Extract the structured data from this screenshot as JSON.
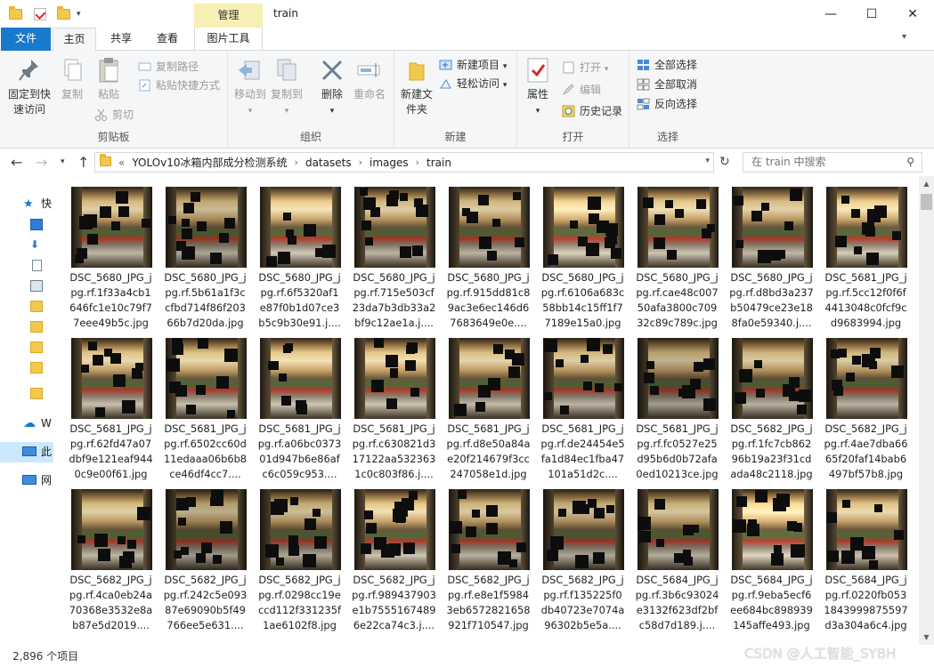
{
  "window": {
    "title": "train",
    "manage_tab": "管理",
    "minimize": "—",
    "maximize": "☐",
    "close": "✕"
  },
  "tabs": {
    "file": "文件",
    "home": "主页",
    "share": "共享",
    "view": "查看",
    "picture_tools": "图片工具"
  },
  "ribbon": {
    "clipboard": {
      "label": "剪贴板",
      "pin": "固定到快速访问",
      "copy": "复制",
      "paste": "粘贴",
      "copy_path": "复制路径",
      "paste_shortcut": "粘贴快捷方式",
      "cut": "剪切"
    },
    "organize": {
      "label": "组织",
      "move_to": "移动到",
      "copy_to": "复制到",
      "delete": "删除",
      "rename": "重命名"
    },
    "new": {
      "label": "新建",
      "new_folder": "新建文件夹",
      "new_item": "新建项目",
      "easy_access": "轻松访问"
    },
    "open": {
      "label": "打开",
      "properties": "属性",
      "open": "打开",
      "edit": "编辑",
      "history": "历史记录"
    },
    "select": {
      "label": "选择",
      "select_all": "全部选择",
      "select_none": "全部取消",
      "invert": "反向选择"
    }
  },
  "address": {
    "overflow": "«",
    "crumbs": [
      "YOLOv10冰箱内部成分检测系统",
      "datasets",
      "images",
      "train"
    ],
    "search_placeholder": "在 train 中搜索"
  },
  "navpane": {
    "quick": "快",
    "onedrive": "W",
    "thispc": "此",
    "network": "网"
  },
  "files": [
    "DSC_5680_JPG_jpg.rf.1f33a4cb1646fc1e10c79f77eee49b5c.jpg",
    "DSC_5680_JPG_jpg.rf.5b61a1f3ccfbd714f86f20366b7d20da.jpg",
    "DSC_5680_JPG_jpg.rf.6f5320af1e87f0b1d07ce3b5c9b30e91.j....",
    "DSC_5680_JPG_jpg.rf.715e503cf23da7b3db33a2bf9c12ae1a.j....",
    "DSC_5680_JPG_jpg.rf.915dd81c89ac3e6ec146d67683649e0e....",
    "DSC_5680_JPG_jpg.rf.6106a683c58bb14c15ff1f77189e15a0.jpg",
    "DSC_5680_JPG_jpg.rf.cae48c00750afa3800c70932c89c789c.jpg",
    "DSC_5680_JPG_jpg.rf.d8bd3a237b50479ce23e188fa0e59340.j....",
    "DSC_5681_JPG_jpg.rf.5cc12f0f6f4413048c0fcf9cd9683994.jpg",
    "DSC_5681_JPG_jpg.rf.62fd47a07dbf9e121eaf9440c9e00f61.jpg",
    "DSC_5681_JPG_jpg.rf.6502cc60d11edaaa06b6b8ce46df4cc7....",
    "DSC_5681_JPG_jpg.rf.a06bc037301d947b6e86afc6c059c953....",
    "DSC_5681_JPG_jpg.rf.c630821d317122aa5323631c0c803f86.j....",
    "DSC_5681_JPG_jpg.rf.d8e50a84ae20f214679f3cc247058e1d.jpg",
    "DSC_5681_JPG_jpg.rf.de24454e5fa1d84ec1fba47101a51d2c....",
    "DSC_5681_JPG_jpg.rf.fc0527e25d95b6d0b72afa0ed10213ce.jpg",
    "DSC_5682_JPG_jpg.rf.1fc7cb86296b19a23f31cdada48c2118.jpg",
    "DSC_5682_JPG_jpg.rf.4ae7dba6665f20faf14bab6497bf57b8.jpg",
    "DSC_5682_JPG_jpg.rf.4ca0eb24a70368e3532e8ab87e5d2019....",
    "DSC_5682_JPG_jpg.rf.242c5e09387e69090b5f49766ee5e631....",
    "DSC_5682_JPG_jpg.rf.0298cc19eccd112f331235f1ae6102f8.jpg",
    "DSC_5682_JPG_jpg.rf.989437903e1b75551674896e22ca74c3.j....",
    "DSC_5682_JPG_jpg.rf.e8e1f59843eb6572821658921f710547.jpg",
    "DSC_5682_JPG_jpg.rf.f135225f0db40723e7074a96302b5e5a....",
    "DSC_5684_JPG_jpg.rf.3b6c93024e3132f623df2bfc58d7d189.j....",
    "DSC_5684_JPG_jpg.rf.9eba5ecf6ee684bc898939145affe493.jpg",
    "DSC_5684_JPG_jpg.rf.0220fb0531843999875597d3a304a6c4.jpg"
  ],
  "status": {
    "item_count": "2,896 个项目"
  },
  "watermark": "CSDN @人工智能_SYBH",
  "colors": {
    "accent": "#1979ca",
    "manage_tab": "#f7f0b5",
    "selection": "#cce8ff"
  }
}
